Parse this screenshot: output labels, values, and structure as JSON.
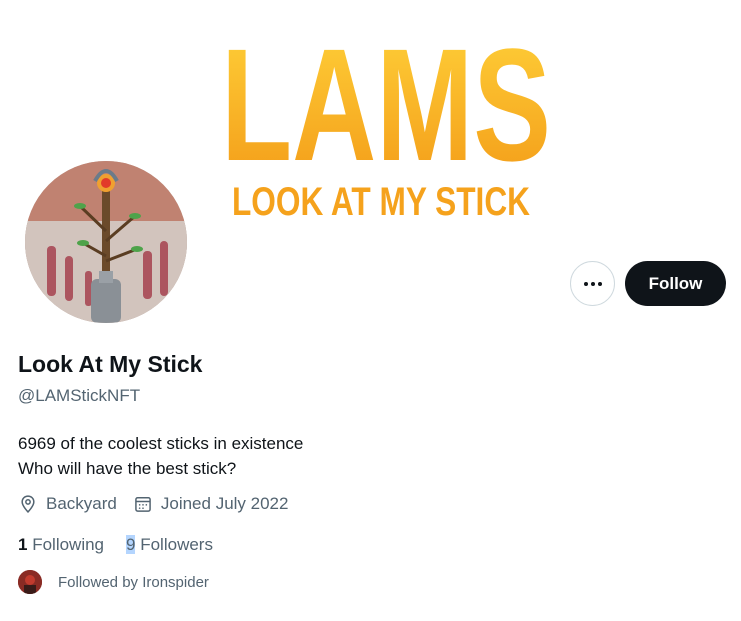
{
  "banner": {
    "title": "LAMS",
    "subtitle": "LOOK AT MY STICK"
  },
  "profile": {
    "display_name": "Look At My Stick",
    "handle": "@LAMStickNFT",
    "bio_lines": [
      "6969 of the coolest sticks in existence",
      "Who will have the best stick?"
    ],
    "location": "Backyard",
    "joined": "Joined July 2022"
  },
  "actions": {
    "follow_label": "Follow",
    "more_icon": "more-horizontal-icon"
  },
  "stats": {
    "following_count": "1",
    "following_label": "Following",
    "followers_count": "9",
    "followers_label": "Followers"
  },
  "followed_by": {
    "text": "Followed by Ironspider"
  },
  "colors": {
    "banner_yellow": "#f7b21a",
    "banner_orange": "#f0912a",
    "follow_bg": "#0f1419",
    "secondary_text": "#536471",
    "selection": "#b4d5fe"
  }
}
